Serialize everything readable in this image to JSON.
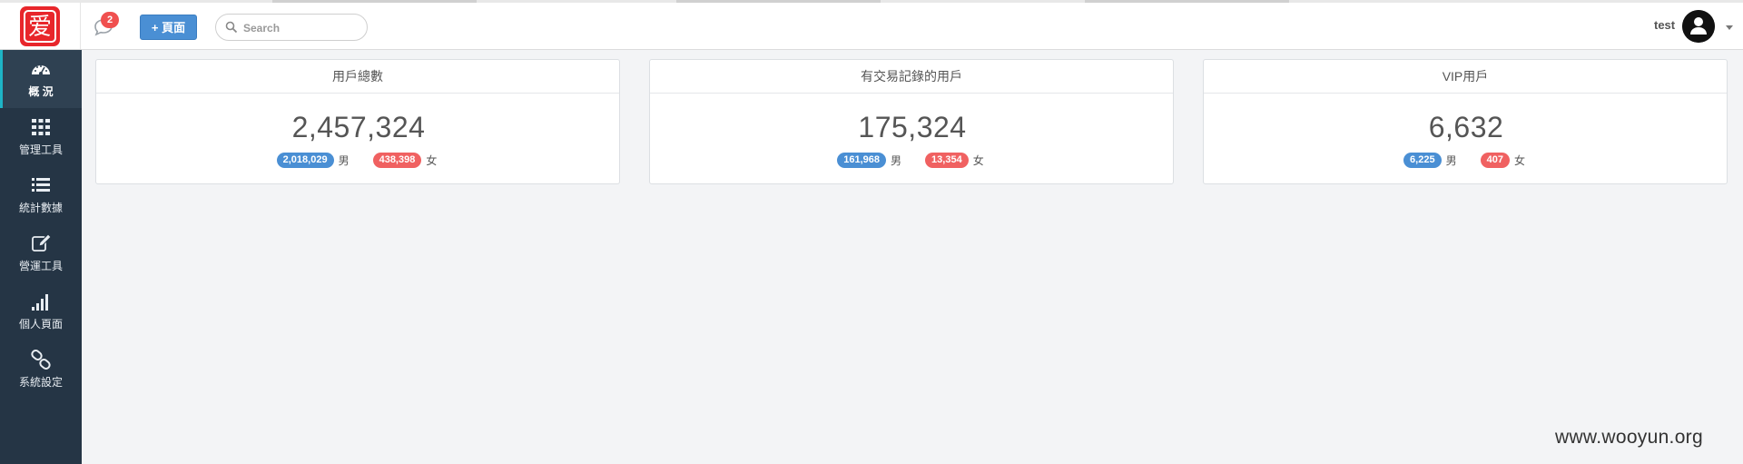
{
  "header": {
    "logo_char": "爱",
    "notification_count": "2",
    "new_page_label": "+ 頁面",
    "search_placeholder": "Search",
    "username": "test"
  },
  "sidebar": {
    "items": [
      {
        "label": "概 況",
        "icon": "dashboard-icon",
        "active": true
      },
      {
        "label": "管理工具",
        "icon": "grid-icon",
        "active": false
      },
      {
        "label": "統計數據",
        "icon": "list-icon",
        "active": false
      },
      {
        "label": "營運工具",
        "icon": "edit-icon",
        "active": false
      },
      {
        "label": "個人頁面",
        "icon": "signal-bars-icon",
        "active": false
      },
      {
        "label": "系統設定",
        "icon": "link-icon",
        "active": false
      }
    ]
  },
  "cards": [
    {
      "title": "用戶總數",
      "total": "2,457,324",
      "male": "2,018,029",
      "male_label": "男",
      "female": "438,398",
      "female_label": "女"
    },
    {
      "title": "有交易記錄的用戶",
      "total": "175,324",
      "male": "161,968",
      "male_label": "男",
      "female": "13,354",
      "female_label": "女"
    },
    {
      "title": "VIP用戶",
      "total": "6,632",
      "male": "6,225",
      "male_label": "男",
      "female": "407",
      "female_label": "女"
    }
  ],
  "colors": {
    "sidebar_bg": "#253545",
    "accent_blue": "#4a8fd4",
    "accent_red": "#f06161",
    "logo_red": "#e8262b",
    "badge_red": "#f0504f"
  },
  "watermark": "www.wooyun.org"
}
